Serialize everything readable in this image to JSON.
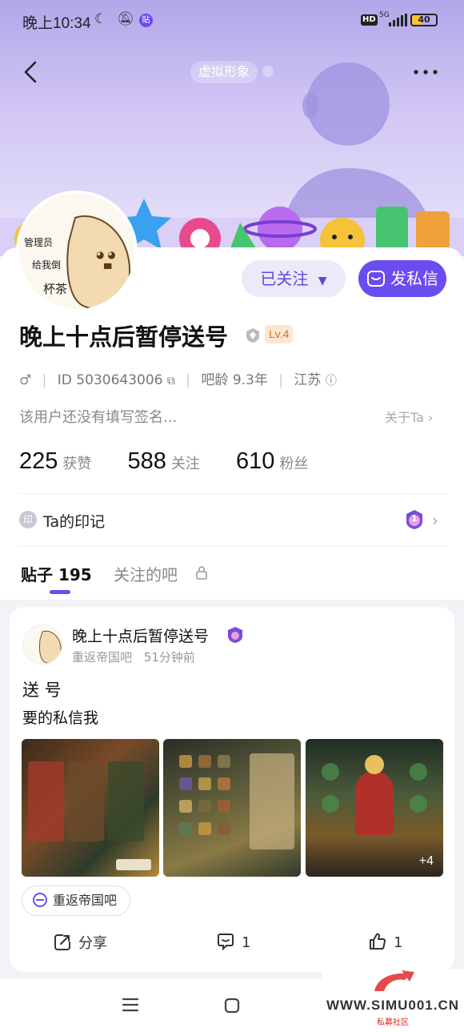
{
  "status_bar": {
    "time": "晚上10:34",
    "app_badge": "贴",
    "hd": "HD",
    "network": "5G",
    "battery": "40"
  },
  "header": {
    "virtual_avatar_label": "虚拟形象"
  },
  "profile": {
    "avatar_text": [
      "管理员",
      "给我倒",
      "杯茶"
    ],
    "follow_label": "已关注",
    "message_label": "发私信",
    "username": "晚上十点后暂停送号",
    "level": "Lv.4",
    "id_text": "ID 5030643006",
    "age_text": "吧龄 9.3年",
    "location": "江苏",
    "signature": "该用户还没有填写签名...",
    "about_label": "关于Ta",
    "stats": [
      {
        "num": "225",
        "label": "获赞"
      },
      {
        "num": "588",
        "label": "关注"
      },
      {
        "num": "610",
        "label": "粉丝"
      }
    ],
    "mark_icon": "印",
    "mark_label": "Ta的印记",
    "mark_badge_num": "1"
  },
  "tabs": [
    {
      "label": "贴子 195"
    },
    {
      "label": "关注的吧"
    }
  ],
  "post": {
    "author": "晚上十点后暂停送号",
    "forum": "重返帝国吧",
    "time_ago": "51分钟前",
    "title": "送 号",
    "body": "要的私信我",
    "more_images": "+4",
    "forum_chip": "重返帝国吧",
    "share_label": "分享",
    "comment_count": "1",
    "like_count": "1"
  },
  "watermark": {
    "text": "WWW.SIMU001.CN",
    "sub": "私募社区"
  },
  "colors": {
    "accent": "#6a4cf0",
    "hero_top": "#b3a6ea",
    "level_bg": "#fde7d3",
    "level_fg": "#d2711c"
  }
}
